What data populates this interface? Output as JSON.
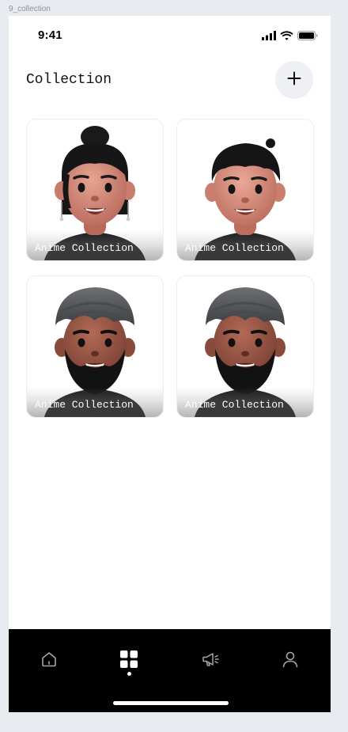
{
  "frame": {
    "label": "9_collection"
  },
  "status_bar": {
    "time": "9:41"
  },
  "header": {
    "title": "Collection"
  },
  "collections": [
    {
      "label": "Anime Collection",
      "avatar": "woman-bun-avatar"
    },
    {
      "label": "Anime Collection",
      "avatar": "man-short-hair-avatar"
    },
    {
      "label": "Anime Collection",
      "avatar": "man-turban-avatar"
    },
    {
      "label": "Anime Collection",
      "avatar": "man-turban-avatar"
    }
  ],
  "bottom_nav": {
    "items": [
      {
        "icon": "home-icon",
        "active": false
      },
      {
        "icon": "grid-icon",
        "active": true
      },
      {
        "icon": "megaphone-icon",
        "active": false
      },
      {
        "icon": "profile-icon",
        "active": false
      }
    ]
  },
  "colors": {
    "background": "#e8ebef",
    "screen": "#ffffff",
    "nav_bar": "#000000",
    "nav_inactive": "#a6a6a6",
    "add_button": "#eef0f3"
  }
}
